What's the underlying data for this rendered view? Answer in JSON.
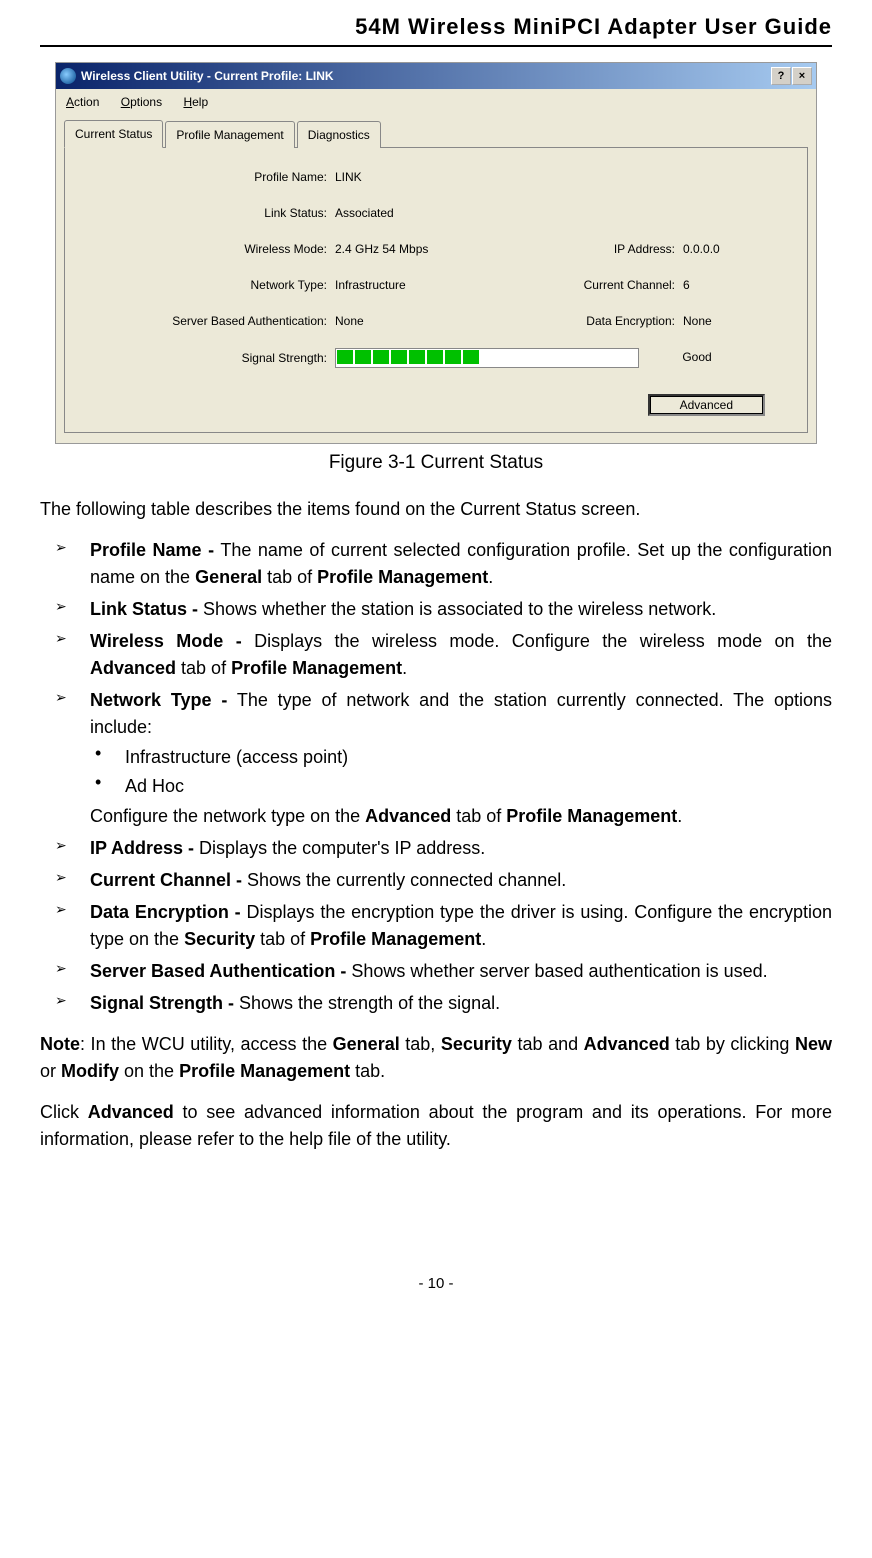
{
  "header": {
    "title": "54M Wireless MiniPCI Adapter User Guide"
  },
  "screenshot": {
    "titlebar": "Wireless Client Utility - Current Profile: LINK",
    "menus": {
      "action": "Action",
      "options": "Options",
      "help": "Help"
    },
    "tabs": {
      "current": "Current Status",
      "profile": "Profile Management",
      "diag": "Diagnostics"
    },
    "status": {
      "profile_name_label": "Profile Name:",
      "profile_name": "LINK",
      "link_status_label": "Link Status:",
      "link_status": "Associated",
      "wireless_mode_label": "Wireless Mode:",
      "wireless_mode": "2.4 GHz 54 Mbps",
      "ip_label": "IP Address:",
      "ip": "0.0.0.0",
      "network_type_label": "Network Type:",
      "network_type": "Infrastructure",
      "channel_label": "Current Channel:",
      "channel": "6",
      "auth_label": "Server Based Authentication:",
      "auth": "None",
      "encryption_label": "Data Encryption:",
      "encryption": "None",
      "signal_label": "Signal Strength:",
      "signal_text": "Good"
    },
    "advanced_btn": "Advanced"
  },
  "caption": "Figure 3-1    Current Status",
  "intro": "The following table describes the items found on the Current Status screen.",
  "items": {
    "profile_name": {
      "title": "Profile Name -",
      "text1": " The name of current selected configuration profile. Set up the configuration name on the ",
      "b1": "General",
      "text2": " tab of ",
      "b2": "Profile Management",
      "text3": "."
    },
    "link_status": {
      "title": "Link Status -",
      "text": " Shows whether the station is associated to the wireless network."
    },
    "wireless_mode": {
      "title": "Wireless Mode -",
      "text1": " Displays the wireless mode. Configure the wireless mode on the ",
      "b1": "Advanced",
      "text2": " tab of ",
      "b2": "Profile Management",
      "text3": "."
    },
    "network_type": {
      "title": "Network Type -",
      "text": " The type of network and the station currently connected. The options include:",
      "sub1": "Infrastructure (access point)",
      "sub2": "Ad Hoc",
      "after1": "Configure the network type on the ",
      "ab1": "Advanced",
      "after2": " tab of ",
      "ab2": "Profile Management",
      "after3": "."
    },
    "ip": {
      "title": "IP Address -",
      "text": " Displays the computer's IP address."
    },
    "channel": {
      "title": "Current Channel -",
      "text": " Shows the currently connected channel."
    },
    "encryption": {
      "title": "Data Encryption -",
      "text1": " Displays the encryption type the driver is using. Configure the encryption type on the ",
      "b1": "Security",
      "text2": " tab of ",
      "b2": "Profile Management",
      "text3": "."
    },
    "auth": {
      "title": "Server Based Authentication -",
      "text": " Shows whether server based authentication is used."
    },
    "signal": {
      "title": "Signal Strength -",
      "text": " Shows the strength of the signal."
    }
  },
  "note": {
    "title": "Note",
    "text1": ": In the WCU utility, access the ",
    "b1": "General",
    "text2": " tab, ",
    "b2": "Security",
    "text3": " tab and ",
    "b3": "Advanced",
    "text4": " tab by clicking ",
    "b4": "New",
    "text5": " or ",
    "b5": "Modify",
    "text6": " on the ",
    "b6": "Profile Management",
    "text7": " tab."
  },
  "last_para": {
    "pre": "Click ",
    "b1": "Advanced",
    "post": " to see advanced information about the program and its operations. For more information, please refer to the help file of the utility."
  },
  "page_num": "- 10 -",
  "chart_data": {
    "type": "bar",
    "title": "Signal Strength",
    "categories": [
      "Signal"
    ],
    "values": [
      50
    ],
    "ylim": [
      0,
      100
    ],
    "label": "Good",
    "segments_filled": 8,
    "segments_total": 16
  }
}
